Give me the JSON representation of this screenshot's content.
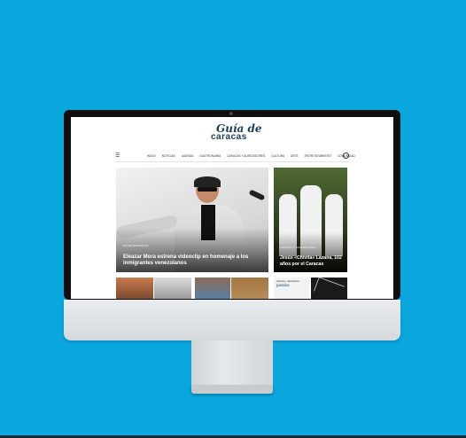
{
  "site": {
    "logo_top": "Guía de",
    "logo_main": "caracas",
    "logo_accent": "#19a5db"
  },
  "nav": {
    "items": [
      "INICIO",
      "NOTICIAS",
      "AGENDA",
      "GASTRONOMÍA",
      "CARACAS Y ALREDEDORES",
      "CULTURA",
      "ARTE",
      "ENTRETENIMIENTO",
      "COMUNIDAD"
    ],
    "menu_icon": "hamburger-icon",
    "search_icon": "search-icon"
  },
  "hero": {
    "category": "Entretenimiento",
    "headline": "Eleazar Mora estrena videoclip en homenaje a los inmigrantes venezolanos"
  },
  "side": {
    "category": "Caracas y alrededores",
    "headline": "Jesús «Chivita» Lazana, 102 años por el Caracas"
  },
  "thumbs": {
    "t5_label": "Caracas y alrededores",
    "t5_logo": "paraíso"
  },
  "colors": {
    "background": "#0aa6de"
  }
}
